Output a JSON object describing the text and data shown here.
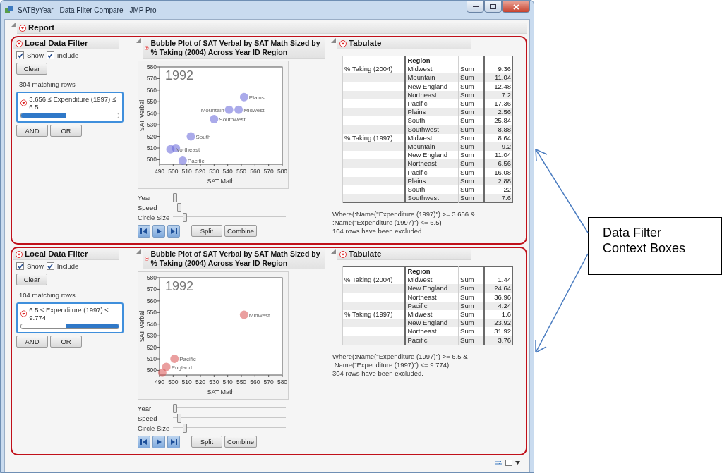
{
  "window": {
    "title": "SATByYear - Data Filter Compare - JMP Pro"
  },
  "report": {
    "title": "Report"
  },
  "contexts": [
    {
      "filter": {
        "title": "Local Data Filter",
        "show": {
          "label": "Show",
          "checked": true
        },
        "include": {
          "label": "Include",
          "checked": true
        },
        "clear": "Clear",
        "matching": "304 matching rows",
        "condition": "3.656 ≤ Expenditure (1997) ≤ 6.5",
        "range": {
          "level": 0.46,
          "from_right": false
        },
        "buttons": [
          "AND",
          "OR"
        ]
      },
      "plot": {
        "title": "Bubble Plot of SAT Verbal by SAT Math Sized by % Taking (2004) Across Year ID Region",
        "year_label": "1992",
        "chart_data": {
          "type": "scatter",
          "xlabel": "SAT Math",
          "ylabel": "SAT Verbal",
          "x": [
            552,
            548,
            541,
            530,
            513,
            498,
            502,
            507
          ],
          "series": [
            {
              "color": "#6464d8",
              "values": [
                554,
                543,
                543,
                535,
                520,
                509,
                510,
                499
              ]
            }
          ],
          "value_labels": [
            "Plains",
            "Midwest",
            "Mountain",
            "Southwest",
            "South",
            "Northeast",
            null,
            "Pacific"
          ],
          "xlim": [
            490,
            580
          ],
          "ylim": [
            496,
            580
          ],
          "xticks": [
            490,
            500,
            510,
            520,
            530,
            540,
            550,
            560,
            570,
            580
          ],
          "yticks": [
            500,
            510,
            520,
            530,
            540,
            550,
            560,
            570,
            580
          ]
        },
        "sliders": [
          {
            "label": "Year",
            "level": 0.0
          },
          {
            "label": "Speed",
            "level": 0.04
          },
          {
            "label": "Circle Size",
            "level": 0.09
          }
        ],
        "buttons": [
          "Split",
          "Combine"
        ]
      },
      "tabulate": {
        "title": "Tabulate",
        "column_2": "Region",
        "rows": [
          {
            "group": "% Taking (2004)",
            "region": "Midwest",
            "stat": "Sum",
            "value": "9.36"
          },
          {
            "region": "Mountain",
            "stat": "Sum",
            "value": "11.04"
          },
          {
            "region": "New England",
            "stat": "Sum",
            "value": "12.48"
          },
          {
            "region": "Northeast",
            "stat": "Sum",
            "value": "7.2"
          },
          {
            "region": "Pacific",
            "stat": "Sum",
            "value": "17.36"
          },
          {
            "region": "Plains",
            "stat": "Sum",
            "value": "2.56"
          },
          {
            "region": "South",
            "stat": "Sum",
            "value": "25.84"
          },
          {
            "region": "Southwest",
            "stat": "Sum",
            "value": "8.88"
          },
          {
            "group": "% Taking (1997)",
            "region": "Midwest",
            "stat": "Sum",
            "value": "8.64"
          },
          {
            "region": "Mountain",
            "stat": "Sum",
            "value": "9.2"
          },
          {
            "region": "New England",
            "stat": "Sum",
            "value": "11.04"
          },
          {
            "region": "Northeast",
            "stat": "Sum",
            "value": "6.56"
          },
          {
            "region": "Pacific",
            "stat": "Sum",
            "value": "16.08"
          },
          {
            "region": "Plains",
            "stat": "Sum",
            "value": "2.88"
          },
          {
            "region": "South",
            "stat": "Sum",
            "value": "22"
          },
          {
            "region": "Southwest",
            "stat": "Sum",
            "value": "7.6"
          }
        ],
        "where": "Where(:Name(\"Expenditure (1997)\") >= 3.656 & :Name(\"Expenditure (1997)\") <= 6.5)",
        "excluded": "104 rows have been excluded."
      }
    },
    {
      "filter": {
        "title": "Local Data Filter",
        "show": {
          "label": "Show",
          "checked": true
        },
        "include": {
          "label": "Include",
          "checked": true
        },
        "clear": "Clear",
        "matching": "104 matching rows",
        "condition": "6.5 ≤ Expenditure (1997) ≤ 9.774",
        "range": {
          "level": 0.54,
          "from_right": true
        },
        "buttons": [
          "AND",
          "OR"
        ]
      },
      "plot": {
        "title": "Bubble Plot of SAT Verbal by SAT Math Sized by % Taking (2004) Across Year ID Region",
        "year_label": "1992",
        "chart_data": {
          "type": "scatter",
          "xlabel": "SAT Math",
          "ylabel": "SAT Verbal",
          "x": [
            552,
            501,
            495,
            492
          ],
          "series": [
            {
              "color": "#d85050",
              "values": [
                548,
                510,
                503,
                498
              ]
            }
          ],
          "value_labels": [
            "Midwest",
            "Pacific",
            "England",
            null
          ],
          "xlim": [
            490,
            580
          ],
          "ylim": [
            496,
            580
          ],
          "xticks": [
            490,
            500,
            510,
            520,
            530,
            540,
            550,
            560,
            570,
            580
          ],
          "yticks": [
            500,
            510,
            520,
            530,
            540,
            550,
            560,
            570,
            580
          ]
        },
        "sliders": [
          {
            "label": "Year",
            "level": 0.0
          },
          {
            "label": "Speed",
            "level": 0.04
          },
          {
            "label": "Circle Size",
            "level": 0.09
          }
        ],
        "buttons": [
          "Split",
          "Combine"
        ]
      },
      "tabulate": {
        "title": "Tabulate",
        "column_2": "Region",
        "rows": [
          {
            "group": "% Taking (2004)",
            "region": "Midwest",
            "stat": "Sum",
            "value": "1.44"
          },
          {
            "region": "New England",
            "stat": "Sum",
            "value": "24.64"
          },
          {
            "region": "Northeast",
            "stat": "Sum",
            "value": "36.96"
          },
          {
            "region": "Pacific",
            "stat": "Sum",
            "value": "4.24"
          },
          {
            "group": "% Taking (1997)",
            "region": "Midwest",
            "stat": "Sum",
            "value": "1.6"
          },
          {
            "region": "New England",
            "stat": "Sum",
            "value": "23.92"
          },
          {
            "region": "Northeast",
            "stat": "Sum",
            "value": "31.92"
          },
          {
            "region": "Pacific",
            "stat": "Sum",
            "value": "3.76"
          }
        ],
        "where": "Where(:Name(\"Expenditure (1997)\") >= 6.5 & :Name(\"Expenditure (1997)\") <= 9.774)",
        "excluded": "304 rows have been excluded."
      }
    }
  ],
  "callout": {
    "text": "Data Filter Context Boxes"
  }
}
